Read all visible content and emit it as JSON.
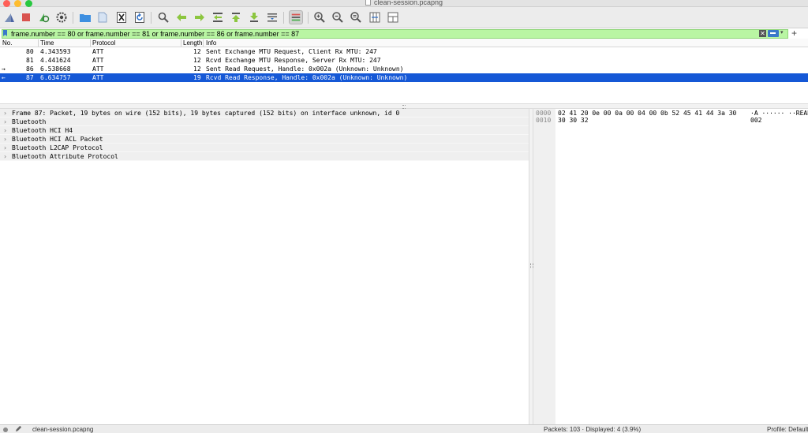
{
  "window": {
    "title": "clean-session.pcapng"
  },
  "toolbar": {
    "buttons": [
      {
        "name": "start-capture-icon",
        "glyph": "shark"
      },
      {
        "name": "stop-capture-icon",
        "glyph": "stop"
      },
      {
        "name": "restart-capture-icon",
        "glyph": "restart"
      },
      {
        "name": "capture-options-icon",
        "glyph": "gear"
      },
      {
        "name": "open-file-icon",
        "glyph": "folder"
      },
      {
        "name": "save-file-icon",
        "glyph": "file"
      },
      {
        "name": "close-file-icon",
        "glyph": "close"
      },
      {
        "name": "reload-file-icon",
        "glyph": "reload"
      },
      {
        "name": "find-packet-icon",
        "glyph": "search"
      },
      {
        "name": "go-back-icon",
        "glyph": "left-arrow"
      },
      {
        "name": "go-forward-icon",
        "glyph": "right-arrow"
      },
      {
        "name": "go-to-packet-icon",
        "glyph": "jump"
      },
      {
        "name": "go-first-icon",
        "glyph": "up-arrow"
      },
      {
        "name": "go-last-icon",
        "glyph": "down-arrow"
      },
      {
        "name": "auto-scroll-icon",
        "glyph": "scroll"
      },
      {
        "name": "colorize-icon",
        "glyph": "lines"
      },
      {
        "name": "zoom-in-icon",
        "glyph": "zoom-in"
      },
      {
        "name": "zoom-out-icon",
        "glyph": "zoom-out"
      },
      {
        "name": "zoom-normal-icon",
        "glyph": "zoom-normal"
      },
      {
        "name": "resize-columns-icon",
        "glyph": "resize"
      },
      {
        "name": "layout-icon",
        "glyph": "layout"
      }
    ]
  },
  "filter": {
    "value": "frame.number == 80 or frame.number == 81 or frame.number == 86 or frame.number == 87",
    "clear_label": "✕",
    "dropdown_label": "▾",
    "add_label": "+"
  },
  "packet_list": {
    "columns": [
      "No.",
      "Time",
      "Protocol",
      "Length",
      "Info"
    ],
    "rows": [
      {
        "marker": "",
        "no": "80",
        "time": "4.343593",
        "protocol": "ATT",
        "length": "12",
        "info": "Sent Exchange MTU Request, Client Rx MTU: 247",
        "selected": false
      },
      {
        "marker": "",
        "no": "81",
        "time": "4.441624",
        "protocol": "ATT",
        "length": "12",
        "info": "Rcvd Exchange MTU Response, Server Rx MTU: 247",
        "selected": false
      },
      {
        "marker": "→",
        "no": "86",
        "time": "6.538668",
        "protocol": "ATT",
        "length": "12",
        "info": "Sent Read Request, Handle: 0x002a (Unknown: Unknown)",
        "selected": false
      },
      {
        "marker": "←",
        "no": "87",
        "time": "6.634757",
        "protocol": "ATT",
        "length": "19",
        "info": "Rcvd Read Response, Handle: 0x002a (Unknown: Unknown)",
        "selected": true
      }
    ]
  },
  "details": {
    "expander": "›",
    "items": [
      "Frame 87: Packet, 19 bytes on wire (152 bits), 19 bytes captured (152 bits) on interface unknown, id 0",
      "Bluetooth",
      "Bluetooth HCI H4",
      "Bluetooth HCI ACL Packet",
      "Bluetooth L2CAP Protocol",
      "Bluetooth Attribute Protocol"
    ]
  },
  "bytes": {
    "rows": [
      {
        "offset": "0000",
        "hex": "02 41 20 0e 00 0a 00 04  00 0b 52 45 41 44 3a 30",
        "ascii": "·A ······ ··READ:0"
      },
      {
        "offset": "0010",
        "hex": "30 30 32",
        "ascii": "002"
      }
    ]
  },
  "status": {
    "file": "clean-session.pcapng",
    "packets": "Packets: 103 · Displayed: 4 (3.9%)",
    "profile": "Profile: Default"
  },
  "colors": {
    "filter_valid": "#b9f5a3",
    "selection": "#1558d6",
    "accent": "#3a78c9"
  }
}
